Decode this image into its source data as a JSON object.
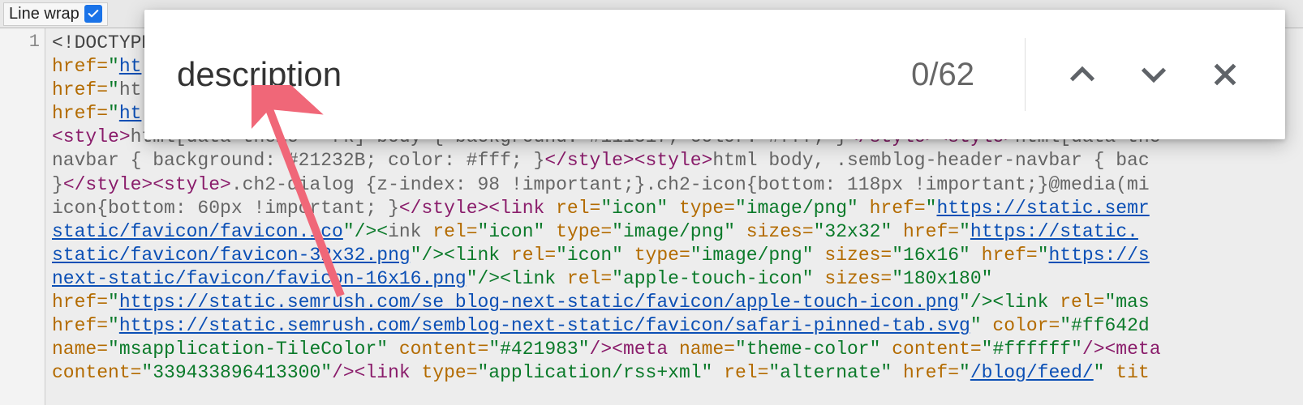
{
  "toolbar": {
    "linewrap_label": "Line wrap",
    "linewrap_checked": true
  },
  "gutter": {
    "line1": "1"
  },
  "search": {
    "query": "description",
    "count": "0/62"
  },
  "code": {
    "line1_decl": "<!DOCTYPE ",
    "line2_attr": "href=",
    "line2_val_start": "\"",
    "line2_link": "ht",
    "line3_attr": "href=",
    "line3_val_start": "\"",
    "line3_text": "ht",
    "line4_attr": "href=",
    "line4_val_start": "\"",
    "line4_link": "ht",
    "line5_tag_open": "<style>",
    "line5_body": "html[data-theme=  rk] body { background: #111317; color: #fff; }",
    "line5_tag_close": "</style>",
    "line5b_tag_open": "<style>",
    "line5b_body": "html[data-the",
    "line6_body_a": "navbar { background: #21232B; color: #fff; }",
    "line6_tag_close": "</style>",
    "line6_tag_open": "<style>",
    "line6_body_b": "html body, .semblog-header-navbar { bac",
    "line7_body_a": "}",
    "line7_tag_close": "</style>",
    "line7_tag_open": "<style>",
    "line7_body_b": ".ch2-dialog {z-index: 98 !important;}.ch2-icon{bottom: 118px !important;}@media(mi",
    "line8_body": "icon{bottom: 60px !important; }",
    "line8_tag_close": "</style>",
    "line8_link_tag": "<link ",
    "line8_rel": "rel=",
    "line8_rel_v": "\"icon\"",
    "line8_type": " type=",
    "line8_type_v": "\"image/png\"",
    "line8_href": " href=",
    "line8_href_q": "\"",
    "line8_href_link": "https://static.semr",
    "line9_link": "static/favicon/favicon.ico",
    "line9_close": "\"/><",
    "line9_text_a": "ink ",
    "line9_rel": "rel=",
    "line9_rel_v": "\"icon\"",
    "line9_type": " type=",
    "line9_type_v": "\"image/png\"",
    "line9_sizes": " sizes=",
    "line9_sizes_v": "\"32x32\"",
    "line9_href": " href=",
    "line9_href_q": "\"",
    "line9_href_link": "https://static.",
    "line10_link": "static/favicon/favicon-32x32.png",
    "line10_close": "\"/><link ",
    "line10_rel": "rel=",
    "line10_rel_v": "\"icon\"",
    "line10_type": " type=",
    "line10_type_v": "\"image/png\"",
    "line10_sizes": " sizes=",
    "line10_sizes_v": "\"16x16\"",
    "line10_href": " href=",
    "line10_href_q": "\"",
    "line10_href_link": "https://s",
    "line11_link": "next-static/favicon/favicon-16x16.png",
    "line11_close": "\"/><link ",
    "line11_rel": "rel=",
    "line11_rel_v": "\"apple-touch-icon\"",
    "line11_sizes": " sizes=",
    "line11_sizes_v": "\"180x180\"",
    "line12_attr": "href=",
    "line12_q": "\"",
    "line12_link": "https://static.semrush.com/se blog-next-static/favicon/apple-touch-icon.png",
    "line12_close": "\"/><link ",
    "line12_rel": "rel=",
    "line12_rel_v": "\"mas",
    "line13_attr": "href=",
    "line13_q": "\"",
    "line13_link": "https://static.semrush.com/semblog-next-static/favicon/safari-pinned-tab.svg",
    "line13_q2": "\"",
    "line13_color": " color=",
    "line13_color_v": "\"#ff642d",
    "line14_name": "name=",
    "line14_name_v": "\"msapplication-TileColor\"",
    "line14_content": " content=",
    "line14_content_v": "\"#421983\"",
    "line14_close": "/><meta ",
    "line14_name2": "name=",
    "line14_name2_v": "\"theme-color\"",
    "line14_content2": " content=",
    "line14_content2_v": "\"#ffffff\"",
    "line14_close2": "/><meta",
    "line15_content": "content=",
    "line15_content_v": "\"339433896413300\"",
    "line15_close": "/><link ",
    "line15_type": "type=",
    "line15_type_v": "\"application/rss+xml\"",
    "line15_rel": " rel=",
    "line15_rel_v": "\"alternate\"",
    "line15_href": " href=",
    "line15_href_q": "\"",
    "line15_href_link": "/blog/feed/",
    "line15_href_q2": "\"",
    "line15_tit": " tit"
  }
}
